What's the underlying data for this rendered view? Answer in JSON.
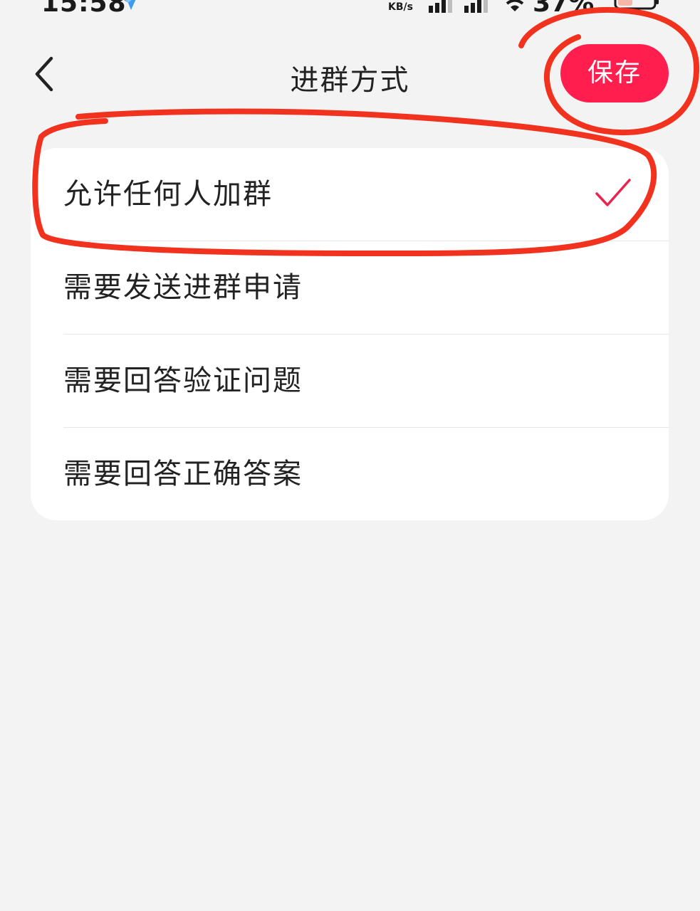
{
  "status_bar": {
    "time": "15:58",
    "network_speed": "KB/s",
    "battery_percent": "37%",
    "app_icon": "app-notification-icon",
    "signal_icon": "signal-icon",
    "wifi_icon": "wifi-icon",
    "battery_icon": "battery-icon"
  },
  "header": {
    "title": "进群方式",
    "back_icon": "chevron-left-icon",
    "save_label": "保存"
  },
  "options": [
    {
      "label": "允许任何人加群",
      "selected": true
    },
    {
      "label": "需要发送进群申请",
      "selected": false
    },
    {
      "label": "需要回答验证问题",
      "selected": false
    },
    {
      "label": "需要回答正确答案",
      "selected": false
    }
  ],
  "colors": {
    "accent": "#ff1e4d",
    "check": "#e8244f",
    "annotation": "#f0321e",
    "background": "#f4f3f3"
  }
}
